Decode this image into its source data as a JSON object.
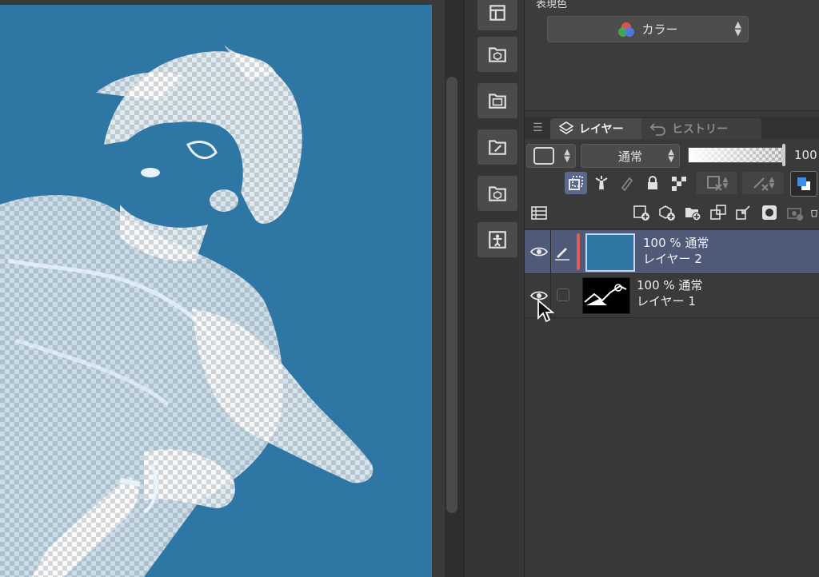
{
  "canvas": {
    "background": "#2e76a4"
  },
  "color_section": {
    "label": "表現色",
    "select_value": "カラー"
  },
  "tabs": {
    "layer": "レイヤー",
    "history": "ヒストリー"
  },
  "controls": {
    "blend_mode": "通常",
    "opacity": "100"
  },
  "layers": [
    {
      "meta": "100 % 通常",
      "name": "レイヤー 2",
      "selected": true
    },
    {
      "meta": "100 % 通常",
      "name": "レイヤー 1",
      "selected": false
    }
  ],
  "colors": {
    "accent": "#4e5a78",
    "red_tag": "#e25c5c",
    "panel": "#3a3a3a"
  }
}
